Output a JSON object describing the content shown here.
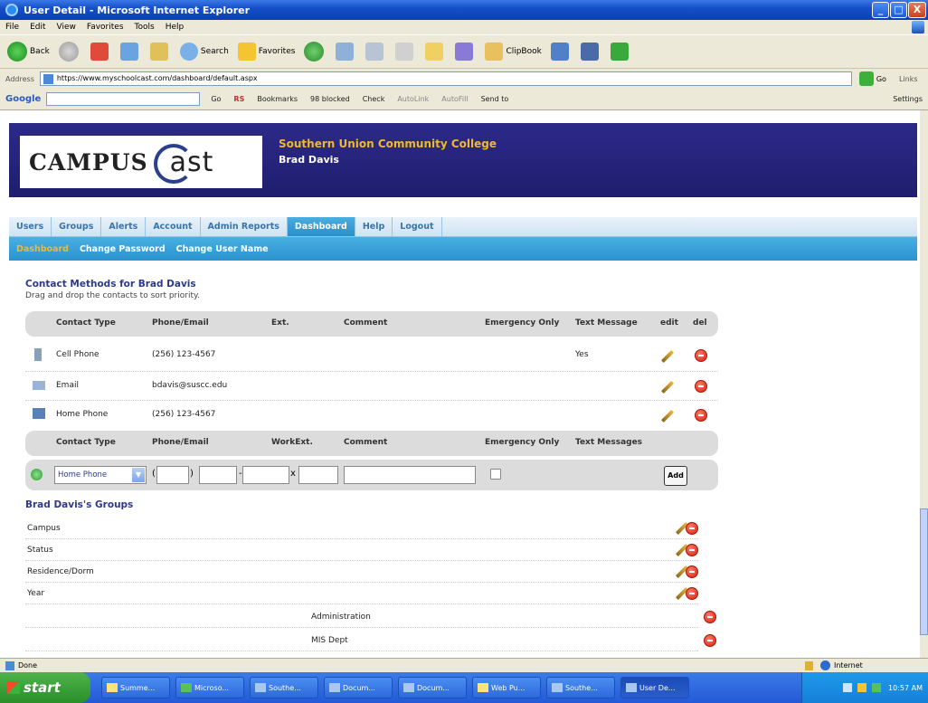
{
  "window": {
    "title": "User Detail - Microsoft Internet Explorer",
    "controls": {
      "minimize": "_",
      "maximize": "□",
      "close": "X"
    }
  },
  "menubar": [
    "File",
    "Edit",
    "View",
    "Favorites",
    "Tools",
    "Help"
  ],
  "toolbar": {
    "back": "Back",
    "search": "Search",
    "favorites": "Favorites",
    "clipbook": "ClipBook"
  },
  "address": {
    "label": "Address",
    "url": "https://www.myschoolcast.com/dashboard/default.aspx",
    "go": "Go",
    "links": "Links"
  },
  "googlebar": {
    "logo": "Google",
    "go": "Go",
    "bookmarks": "Bookmarks",
    "blocked": "98 blocked",
    "check": "Check",
    "autolink": "AutoLink",
    "autofill": "AutoFill",
    "sendto": "Send to",
    "settings": "Settings"
  },
  "header": {
    "logo_left": "CAMPUS",
    "logo_right": "ast",
    "college": "Southern Union Community College",
    "user": "Brad Davis"
  },
  "tabs": [
    "Users",
    "Groups",
    "Alerts",
    "Account",
    "Admin Reports",
    "Dashboard",
    "Help",
    "Logout"
  ],
  "subtabs": [
    "Dashboard",
    "Change Password",
    "Change User Name"
  ],
  "contacts": {
    "title": "Contact Methods for Brad Davis",
    "subtitle": "Drag and drop the contacts to sort priority.",
    "headers": {
      "type": "Contact Type",
      "phone": "Phone/Email",
      "ext": "Ext.",
      "comment": "Comment",
      "emergency": "Emergency Only",
      "text": "Text Message",
      "edit": "edit",
      "del": "del"
    },
    "rows": [
      {
        "type": "Cell Phone",
        "value": "(256) 123-4567",
        "text": "Yes"
      },
      {
        "type": "Email",
        "value": "bdavis@suscc.edu",
        "text": ""
      },
      {
        "type": "Home Phone",
        "value": "(256) 123-4567",
        "text": ""
      }
    ],
    "add_headers": {
      "type": "Contact Type",
      "phone": "Phone/Email",
      "ext": "WorkExt.",
      "comment": "Comment",
      "emergency": "Emergency Only",
      "text": "Text Messages"
    },
    "add_row": {
      "selected": "Home Phone",
      "open_paren": "(",
      "close_paren": ")",
      "dash": "-",
      "x": "x",
      "add": "Add"
    }
  },
  "groups": {
    "title": "Brad Davis's Groups",
    "items": [
      {
        "label": "Campus",
        "indent": false
      },
      {
        "label": "Status",
        "indent": false
      },
      {
        "label": "Residence/Dorm",
        "indent": false
      },
      {
        "label": "Year",
        "indent": false
      },
      {
        "label": "Administration",
        "indent": true
      },
      {
        "label": "MIS Dept",
        "indent": true
      }
    ]
  },
  "status": {
    "text": "Done",
    "zone": "Internet"
  },
  "taskbar": {
    "start": "start",
    "tasks": [
      "Summe...",
      "Microso...",
      "Southe...",
      "Docum...",
      "Docum...",
      "Web Pu...",
      "Southe...",
      "User De..."
    ],
    "clock": "10:57 AM"
  }
}
